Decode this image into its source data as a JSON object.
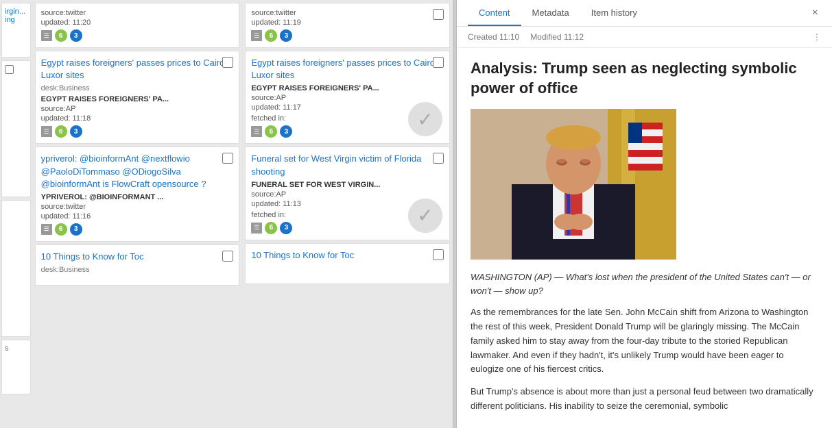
{
  "tabs": {
    "content_label": "Content",
    "metadata_label": "Metadata",
    "item_history_label": "Item history",
    "active": "content"
  },
  "meta": {
    "created_label": "Created",
    "created_time": "11:10",
    "modified_label": "Modified",
    "modified_time": "11:12"
  },
  "article": {
    "title": "Analysis: Trump seen as neglecting symbolic power of office",
    "dateline": "WASHINGTON (AP) — What's lost when the president of the United States can't — or won't — show up?",
    "body1": "As the remembrances for the late Sen. John McCain shift from Arizona to Washington the rest of this week, President Donald Trump will be glaringly missing. The McCain family asked him to stay away from the four-day tribute to the storied Republican lawmaker. And even if they hadn't, it's unlikely Trump would have been eager to eulogize one of his fiercest critics.",
    "body2": "But Trump's absence is about more than just a personal feud between two dramatically different politicians. His inability to seize the ceremonial, symbolic"
  },
  "col1": {
    "cards": [
      {
        "id": "c1-1",
        "title_link": "",
        "source": "source:twitter",
        "updated": "updated: 11:20",
        "badges": [
          {
            "type": "icon"
          },
          {
            "num": "6",
            "color": "green"
          },
          {
            "num": "3",
            "color": "blue"
          }
        ],
        "partial": true,
        "partial_title": "irgin...",
        "partial_desk": "ing"
      },
      {
        "id": "c1-2",
        "title_link": "Egypt raises foreigners' passes prices to Cairo, Luxor sites",
        "desk": "desk:Business",
        "big_title": "EGYPT RAISES FOREIGNERS' PA...",
        "source": "source:AP",
        "updated": "updated: 11:18",
        "badges": [
          {
            "type": "icon"
          },
          {
            "num": "6",
            "color": "green"
          },
          {
            "num": "3",
            "color": "blue"
          }
        ]
      },
      {
        "id": "c1-3",
        "title_link": "ypriverol: @bioinformAnt @nextflowio @PaoloDiTommaso @ODiogoSilva @bioinformAnt is FlowCraft opensource ?",
        "big_title": "YPRIVEROL: @BIOINFORMANT ...",
        "source": "source:twitter",
        "updated": "updated: 11:16",
        "badges": [
          {
            "type": "icon"
          },
          {
            "num": "6",
            "color": "green"
          },
          {
            "num": "3",
            "color": "blue"
          }
        ]
      },
      {
        "id": "c1-4",
        "title_link": "10 Things to Know for Toc",
        "desk": "desk:Business",
        "partial_bottom": true
      }
    ]
  },
  "col2": {
    "cards": [
      {
        "id": "c2-1",
        "title_link": "",
        "source": "source:twitter",
        "updated": "updated: 11:19",
        "badges": [
          {
            "type": "icon"
          },
          {
            "num": "6",
            "color": "green"
          },
          {
            "num": "3",
            "color": "blue"
          }
        ]
      },
      {
        "id": "c2-2",
        "title_link": "Egypt raises foreigners' passes prices to Cairo, Luxor sites",
        "big_title": "EGYPT RAISES FOREIGNERS' PA...",
        "source": "source:AP",
        "updated": "updated: 11:17",
        "fetched": "fetched in:",
        "badges": [
          {
            "type": "icon"
          },
          {
            "num": "6",
            "color": "green"
          },
          {
            "num": "3",
            "color": "blue"
          }
        ],
        "checkmark": true
      },
      {
        "id": "c2-3",
        "title_link": "Funeral set for West Virgin victim of Florida shooting",
        "big_title": "FUNERAL SET FOR WEST VIRGIN...",
        "source": "source:AP",
        "updated": "updated: 11:13",
        "fetched": "fetched in:",
        "badges": [
          {
            "type": "icon"
          },
          {
            "num": "6",
            "color": "green"
          },
          {
            "num": "3",
            "color": "blue"
          }
        ],
        "checkmark": true
      },
      {
        "id": "c2-4",
        "title_link": "10 Things to Know for Toc",
        "partial_bottom": true
      }
    ]
  },
  "icons": {
    "close": "×",
    "more": "⋮",
    "checkmark": "✓",
    "doc": "☰"
  }
}
